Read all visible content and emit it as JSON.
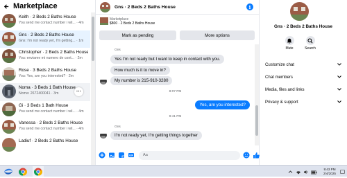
{
  "left": {
    "title": "Marketplace",
    "conversations": [
      {
        "title": "Keith · 2 Beds 2 Baths House",
        "preview": "You send me contact number i wil... · 4m"
      },
      {
        "title": "Gns · 2 Beds 2 Baths House",
        "preview": "Gns: I'm not ready yet, I'm getting... · 1m"
      },
      {
        "title": "Christopher · 2 Beds 2 Baths House",
        "preview": "You: enviame mi numero de cont... · 2m"
      },
      {
        "title": "Rose · 3 Beds 2 Baths House",
        "preview": "You: Yes, are you interested? · 2m"
      },
      {
        "title": "Noma · 3 Beds 1 Bath House",
        "preview": "Noma: 2672400041 · 3m"
      },
      {
        "title": "Gi · 3 Beds 1 Bath House",
        "preview": "You send me contact number i wil... · 4m"
      },
      {
        "title": "Vanessa · 2 Beds 2 Baths House",
        "preview": "You send me contact number i wil... · 4m"
      },
      {
        "title": "Ladiuf · 2 Beds 2 Baths House",
        "preview": ""
      }
    ],
    "more_glyph": "···"
  },
  "chat": {
    "header_name": "Gns · 2 Beds 2 Baths House",
    "info_glyph": "i",
    "marketplace_label": "Marketplace",
    "listing_text": "$800 · 2 Beds 2 Baths House",
    "mark_pending_label": "Mark as pending",
    "more_options_label": "More options",
    "messages": [
      {
        "sender": "Gns"
      },
      {
        "text": "Yes I'm not ready but I want to keep in contact with you."
      },
      {
        "text": "How much is it to move in?"
      },
      {
        "text": "My number is 215-910-3280"
      },
      {
        "timestamp": "8:07 PM"
      },
      {
        "text": "Yes, are you interested?"
      },
      {
        "timestamp": "9:41 PM"
      },
      {
        "sender": "Gns"
      },
      {
        "text": "I'm not ready yet, I'm getting things together"
      }
    ],
    "composer_placeholder": "Aa"
  },
  "right": {
    "name": "Gns · 2 Beds 2 Baths House",
    "mute_label": "Mute",
    "search_label": "Search",
    "sections": [
      "Customize chat",
      "Chat members",
      "Media, files and links",
      "Privacy & support"
    ]
  },
  "taskbar": {
    "time": "9:43 PM",
    "date": "2/4/2025"
  },
  "colors": {
    "accent": "#0a7cff",
    "bubble_in": "#e4e6eb",
    "active_row": "#e7f3ff"
  }
}
